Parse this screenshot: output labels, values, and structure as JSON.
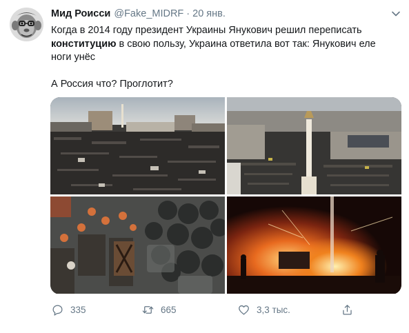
{
  "author": {
    "display_name": "Мид Роисси",
    "handle": "@Fake_MIDRF",
    "separator": "·",
    "time": "20 янв."
  },
  "tweet": {
    "text_part1": "Когда в 2014 году президент Украины Янукович решил переписать ",
    "text_bold": "конституцию",
    "text_part2": " в свою пользу, Украина ответила вот так: Янукович еле ноги унёс",
    "text_para2": "А Россия что? Проглотит?"
  },
  "media": {
    "photos": [
      {
        "subject": "crowd-square-aerial"
      },
      {
        "subject": "independence-monument-crowd"
      },
      {
        "subject": "riot-police-clash"
      },
      {
        "subject": "fires-night-protest"
      }
    ]
  },
  "actions": {
    "reply_count": "335",
    "retweet_count": "665",
    "like_count": "3,3 тыс."
  },
  "icons": {
    "reply": "speech-bubble-icon",
    "retweet": "retweet-arrows-icon",
    "like": "heart-icon",
    "share": "share-icon",
    "more": "chevron-down-icon"
  },
  "colors": {
    "text_primary": "#14171a",
    "text_secondary": "#657786",
    "background": "#ffffff"
  }
}
